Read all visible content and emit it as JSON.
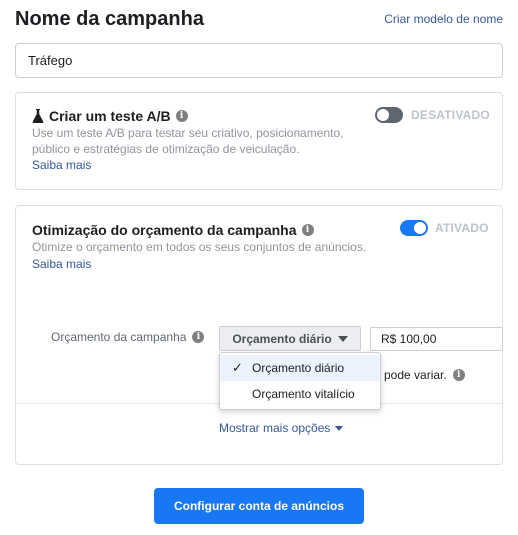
{
  "header": {
    "title": "Nome da campanha",
    "template_link": "Criar modelo de nome"
  },
  "campaign_name": {
    "value": "Tráfego"
  },
  "ab_test": {
    "icon": "flask-icon",
    "title": "Criar um teste A/B",
    "description": "Use um teste A/B para testar seu criativo, posicionamento, público e estratégias de otimização de veiculação.",
    "learn_more": "Saiba mais",
    "toggle_label": "DESATIVADO",
    "enabled": false
  },
  "cbo": {
    "title": "Otimização do orçamento da campanha",
    "description": "Otimize o orçamento em todos os seus conjuntos de anúncios.",
    "learn_more": "Saiba mais",
    "toggle_label": "ATIVADO",
    "enabled": true,
    "budget_label": "Orçamento da campanha",
    "budget_type_selected": "Orçamento diário",
    "budget_amount": "R$ 100,00",
    "note": "pode variar.",
    "dropdown_options": [
      "Orçamento diário",
      "Orçamento vitalício"
    ],
    "show_more": "Mostrar mais opções"
  },
  "footer": {
    "cta": "Configurar conta de anúncios"
  },
  "colors": {
    "accent": "#1877f2",
    "link": "#365899",
    "toggle_off": "#606770"
  }
}
